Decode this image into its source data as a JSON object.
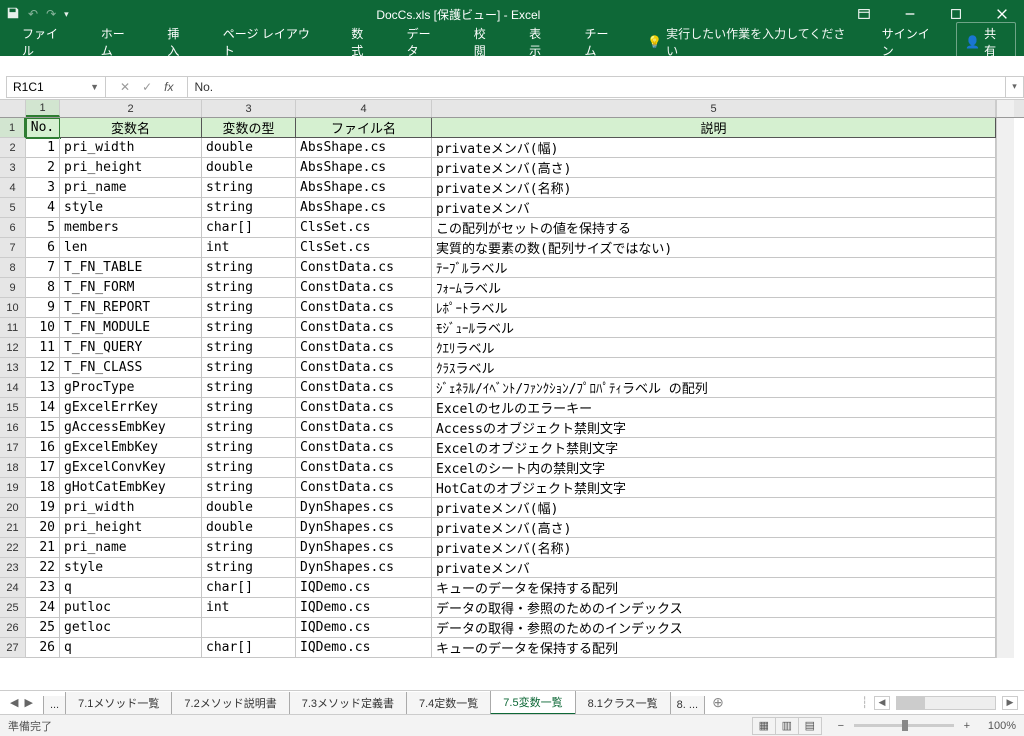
{
  "titlebar": {
    "title": "DocCs.xls [保護ビュー] - Excel"
  },
  "ribbon": {
    "tabs": [
      "ファイル",
      "ホーム",
      "挿入",
      "ページ レイアウト",
      "数式",
      "データ",
      "校閲",
      "表示",
      "チーム"
    ],
    "tellme": "実行したい作業を入力してください",
    "signin": "サインイン",
    "share": "共有"
  },
  "namebox": "R1C1",
  "formula": "No.",
  "columns": [
    "1",
    "2",
    "3",
    "4",
    "5"
  ],
  "headers": {
    "no": "No.",
    "var": "変数名",
    "type": "変数の型",
    "file": "ファイル名",
    "desc": "説明"
  },
  "rows": [
    {
      "n": "1",
      "v": "pri_width",
      "t": "double",
      "f": "AbsShape.cs",
      "d": "privateメンバ(幅)"
    },
    {
      "n": "2",
      "v": "pri_height",
      "t": "double",
      "f": "AbsShape.cs",
      "d": "privateメンバ(高さ)"
    },
    {
      "n": "3",
      "v": "pri_name",
      "t": "string",
      "f": "AbsShape.cs",
      "d": "privateメンバ(名称)"
    },
    {
      "n": "4",
      "v": "style",
      "t": "string",
      "f": "AbsShape.cs",
      "d": "privateメンバ"
    },
    {
      "n": "5",
      "v": "members",
      "t": "char[]",
      "f": "ClsSet.cs",
      "d": "この配列がセットの値を保持する"
    },
    {
      "n": "6",
      "v": "len",
      "t": "int",
      "f": "ClsSet.cs",
      "d": "実質的な要素の数(配列サイズではない)"
    },
    {
      "n": "7",
      "v": "T_FN_TABLE",
      "t": "string",
      "f": "ConstData.cs",
      "d": "ﾃｰﾌﾞﾙラベル"
    },
    {
      "n": "8",
      "v": "T_FN_FORM",
      "t": "string",
      "f": "ConstData.cs",
      "d": "ﾌｫｰﾑラベル"
    },
    {
      "n": "9",
      "v": "T_FN_REPORT",
      "t": "string",
      "f": "ConstData.cs",
      "d": "ﾚﾎﾟｰﾄラベル"
    },
    {
      "n": "10",
      "v": "T_FN_MODULE",
      "t": "string",
      "f": "ConstData.cs",
      "d": "ﾓｼﾞｭｰﾙラベル"
    },
    {
      "n": "11",
      "v": "T_FN_QUERY",
      "t": "string",
      "f": "ConstData.cs",
      "d": "ｸｴﾘラベル"
    },
    {
      "n": "12",
      "v": "T_FN_CLASS",
      "t": "string",
      "f": "ConstData.cs",
      "d": "ｸﾗｽラベル"
    },
    {
      "n": "13",
      "v": "gProcType",
      "t": "string",
      "f": "ConstData.cs",
      "d": "ｼﾞｪﾈﾗﾙ/ｲﾍﾞﾝﾄ/ﾌｧﾝｸｼｮﾝ/ﾌﾟﾛﾊﾟﾃｨラベル の配列"
    },
    {
      "n": "14",
      "v": "gExcelErrKey",
      "t": "string",
      "f": "ConstData.cs",
      "d": "Excelのセルのエラーキー"
    },
    {
      "n": "15",
      "v": "gAccessEmbKey",
      "t": "string",
      "f": "ConstData.cs",
      "d": "Accessのオブジェクト禁則文字"
    },
    {
      "n": "16",
      "v": "gExcelEmbKey",
      "t": "string",
      "f": "ConstData.cs",
      "d": "Excelのオブジェクト禁則文字"
    },
    {
      "n": "17",
      "v": "gExcelConvKey",
      "t": "string",
      "f": "ConstData.cs",
      "d": "Excelのシート内の禁則文字"
    },
    {
      "n": "18",
      "v": "gHotCatEmbKey",
      "t": "string",
      "f": "ConstData.cs",
      "d": "HotCatのオブジェクト禁則文字"
    },
    {
      "n": "19",
      "v": "pri_width",
      "t": "double",
      "f": "DynShapes.cs",
      "d": "privateメンバ(幅)"
    },
    {
      "n": "20",
      "v": "pri_height",
      "t": "double",
      "f": "DynShapes.cs",
      "d": "privateメンバ(高さ)"
    },
    {
      "n": "21",
      "v": "pri_name",
      "t": "string",
      "f": "DynShapes.cs",
      "d": "privateメンバ(名称)"
    },
    {
      "n": "22",
      "v": "style",
      "t": "string",
      "f": "DynShapes.cs",
      "d": "privateメンバ"
    },
    {
      "n": "23",
      "v": "q",
      "t": "char[]",
      "f": "IQDemo.cs",
      "d": "キューのデータを保持する配列"
    },
    {
      "n": "24",
      "v": "putloc",
      "t": "int",
      "f": "IQDemo.cs",
      "d": "データの取得・参照のためのインデックス"
    },
    {
      "n": "25",
      "v": "getloc",
      "t": "",
      "f": "IQDemo.cs",
      "d": "データの取得・参照のためのインデックス"
    },
    {
      "n": "26",
      "v": "q",
      "t": "char[]",
      "f": "IQDemo.cs",
      "d": "キューのデータを保持する配列"
    }
  ],
  "sheets": {
    "overflow_left": "...",
    "tabs": [
      "7.1メソッド一覧",
      "7.2メソッド説明書",
      "7.3メソッド定義書",
      "7.4定数一覧",
      "7.5変数一覧",
      "8.1クラス一覧"
    ],
    "overflow_right": "8. ...",
    "active": 4
  },
  "status": {
    "ready": "準備完了",
    "zoom": "100%"
  }
}
